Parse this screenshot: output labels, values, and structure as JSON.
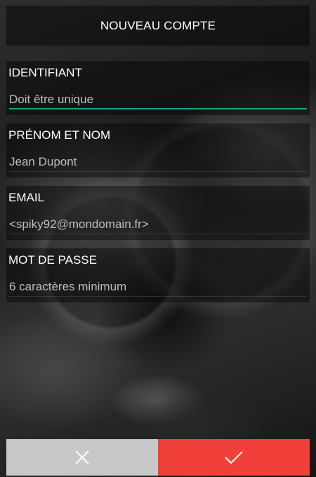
{
  "header": {
    "title": "NOUVEAU COMPTE"
  },
  "form": {
    "fields": [
      {
        "label": "IDENTIFIANT",
        "value": "",
        "placeholder": "Doit être unique"
      },
      {
        "label": "PRÉNOM ET NOM",
        "value": "",
        "placeholder": "Jean Dupont"
      },
      {
        "label": "EMAIL",
        "value": "",
        "placeholder": "<spiky92@mondomain.fr>"
      },
      {
        "label": "MOT DE PASSE",
        "value": "",
        "placeholder": "6 caractères minimum"
      }
    ]
  },
  "actions": {
    "cancel_icon": "close-icon",
    "confirm_icon": "check-icon"
  },
  "colors": {
    "accent": "#1aa295",
    "confirm": "#f1403a",
    "cancel": "#c8c8c8"
  }
}
